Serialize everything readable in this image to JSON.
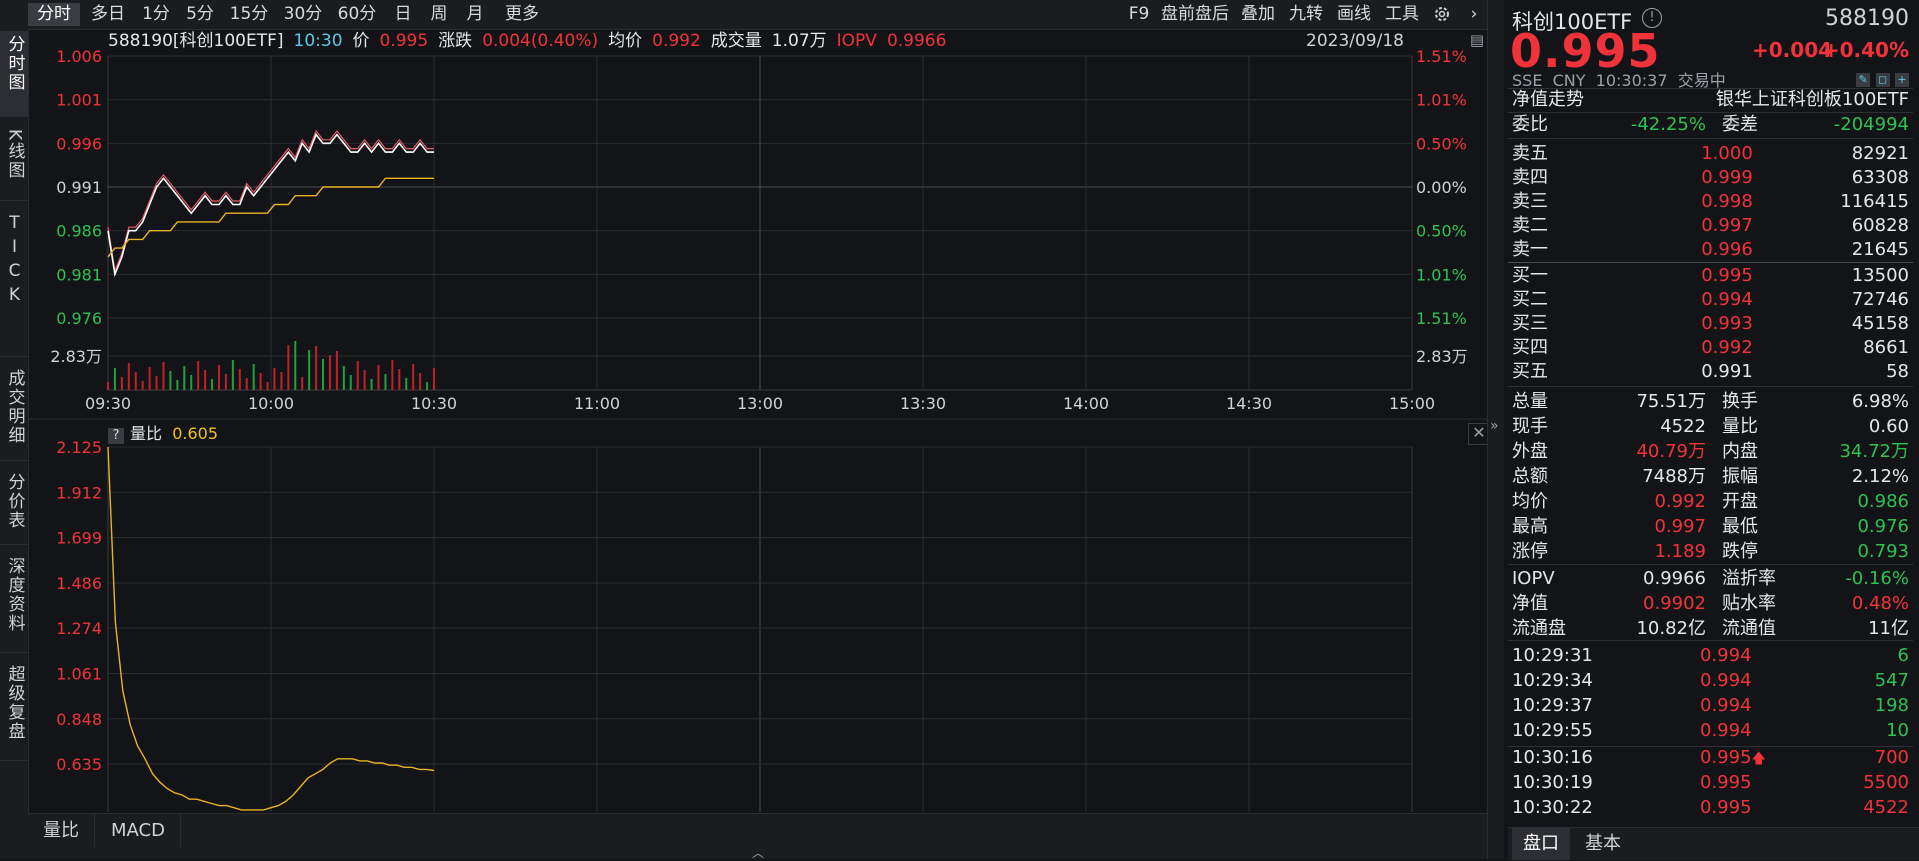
{
  "toolbar": {
    "periods": [
      "分时",
      "多日",
      "1分",
      "5分",
      "15分",
      "30分",
      "60分",
      "日",
      "周",
      "月",
      "更多"
    ],
    "tools": [
      "F9",
      "盘前盘后",
      "叠加",
      "九转",
      "画线",
      "工具"
    ]
  },
  "left_tabs": [
    "分时图",
    "K线图",
    "TICK",
    "成交明细",
    "分价表",
    "深度资料",
    "超级复盘"
  ],
  "info": {
    "code_name": "588190[科创100ETF]",
    "time": "10:30",
    "price_label": "价",
    "price": "0.995",
    "change_label": "涨跌",
    "change": "0.004(0.40%)",
    "avg_label": "均价",
    "avg": "0.992",
    "vol_label": "成交量",
    "vol": "1.07万",
    "iopv_label": "IOPV",
    "iopv": "0.9966",
    "date": "2023/09/18"
  },
  "chart_data": [
    {
      "type": "line",
      "x_ticks": [
        "09:30",
        "10:00",
        "10:30",
        "11:00",
        "13:00",
        "13:30",
        "14:00",
        "14:30",
        "15:00"
      ],
      "y_ticks_left": [
        "1.006",
        "1.001",
        "0.996",
        "0.991",
        "0.986",
        "0.981",
        "0.976"
      ],
      "y_ticks_right": [
        "1.51%",
        "1.01%",
        "0.50%",
        "0.00%",
        "0.50%",
        "1.01%",
        "1.51%"
      ],
      "ylim": [
        0.976,
        1.006
      ],
      "prev_close": 0.991,
      "volume_label": "2.83万",
      "series": [
        {
          "values": [
            0.986,
            0.981,
            0.983,
            0.986,
            0.986,
            0.987,
            0.989,
            0.991,
            0.992,
            0.991,
            0.99,
            0.989,
            0.988,
            0.989,
            0.99,
            0.989,
            0.989,
            0.99,
            0.989,
            0.989,
            0.991,
            0.99,
            0.991,
            0.992,
            0.993,
            0.994,
            0.995,
            0.994,
            0.996,
            0.995,
            0.997,
            0.996,
            0.996,
            0.997,
            0.996,
            0.995,
            0.995,
            0.996,
            0.995,
            0.996,
            0.995,
            0.995,
            0.996,
            0.995,
            0.995,
            0.996,
            0.995,
            0.995
          ]
        },
        {
          "values": [
            0.983,
            0.984,
            0.984,
            0.985,
            0.985,
            0.985,
            0.986,
            0.986,
            0.986,
            0.986,
            0.987,
            0.987,
            0.987,
            0.987,
            0.987,
            0.987,
            0.987,
            0.988,
            0.988,
            0.988,
            0.988,
            0.988,
            0.988,
            0.988,
            0.989,
            0.989,
            0.989,
            0.99,
            0.99,
            0.99,
            0.99,
            0.991,
            0.991,
            0.991,
            0.991,
            0.991,
            0.991,
            0.991,
            0.991,
            0.991,
            0.992,
            0.992,
            0.992,
            0.992,
            0.992,
            0.992,
            0.992,
            0.992
          ]
        }
      ]
    },
    {
      "type": "line",
      "title": "量比",
      "y_ticks": [
        "2.125",
        "1.912",
        "1.699",
        "1.486",
        "1.274",
        "1.061",
        "0.848",
        "0.635"
      ],
      "ylim": [
        0.41,
        2.125
      ],
      "series": [
        {
          "name": "量比",
          "values": [
            2.125,
            1.3,
            0.98,
            0.82,
            0.72,
            0.66,
            0.59,
            0.55,
            0.52,
            0.5,
            0.49,
            0.47,
            0.47,
            0.46,
            0.45,
            0.44,
            0.44,
            0.43,
            0.42,
            0.42,
            0.42,
            0.42,
            0.43,
            0.44,
            0.46,
            0.49,
            0.53,
            0.57,
            0.59,
            0.61,
            0.64,
            0.66,
            0.66,
            0.66,
            0.65,
            0.65,
            0.64,
            0.64,
            0.63,
            0.63,
            0.62,
            0.62,
            0.61,
            0.61,
            0.605
          ]
        }
      ]
    }
  ],
  "sub_pane": {
    "label": "量比",
    "value": "0.605"
  },
  "bottom_tabs": [
    "量比",
    "MACD"
  ],
  "quote": {
    "name": "科创100ETF",
    "code": "588190",
    "price": "0.995",
    "change": "+0.004",
    "change_pct": "+0.40%",
    "meta": "SSE  CNY  10:30:37  交易中",
    "trend_label": "净值走势",
    "index_name": "银华上证科创板100ETF"
  },
  "ratio": {
    "wb_label": "委比",
    "wb": "-42.25%",
    "wc_label": "委差",
    "wc": "-204994"
  },
  "asks": [
    {
      "label": "卖五",
      "price": "1.000",
      "vol": "82921"
    },
    {
      "label": "卖四",
      "price": "0.999",
      "vol": "63308"
    },
    {
      "label": "卖三",
      "price": "0.998",
      "vol": "116415"
    },
    {
      "label": "卖二",
      "price": "0.997",
      "vol": "60828"
    },
    {
      "label": "卖一",
      "price": "0.996",
      "vol": "21645"
    }
  ],
  "bids": [
    {
      "label": "买一",
      "price": "0.995",
      "vol": "13500"
    },
    {
      "label": "买二",
      "price": "0.994",
      "vol": "72746"
    },
    {
      "label": "买三",
      "price": "0.993",
      "vol": "45158"
    },
    {
      "label": "买四",
      "price": "0.992",
      "vol": "8661"
    },
    {
      "label": "买五",
      "price": "0.991",
      "vol": "58"
    }
  ],
  "stats": [
    {
      "l1": "总量",
      "v1": "75.51万",
      "c1": "white",
      "l2": "换手",
      "v2": "6.98%",
      "c2": "white"
    },
    {
      "l1": "现手",
      "v1": "4522",
      "c1": "white",
      "l2": "量比",
      "v2": "0.60",
      "c2": "white"
    },
    {
      "l1": "外盘",
      "v1": "40.79万",
      "c1": "red",
      "l2": "内盘",
      "v2": "34.72万",
      "c2": "green"
    },
    {
      "l1": "总额",
      "v1": "7488万",
      "c1": "white",
      "l2": "振幅",
      "v2": "2.12%",
      "c2": "white"
    },
    {
      "l1": "均价",
      "v1": "0.992",
      "c1": "red",
      "l2": "开盘",
      "v2": "0.986",
      "c2": "green"
    },
    {
      "l1": "最高",
      "v1": "0.997",
      "c1": "red",
      "l2": "最低",
      "v2": "0.976",
      "c2": "green"
    },
    {
      "l1": "涨停",
      "v1": "1.189",
      "c1": "red",
      "l2": "跌停",
      "v2": "0.793",
      "c2": "green"
    },
    {
      "l1": "IOPV",
      "v1": "0.9966",
      "c1": "white",
      "l2": "溢折率",
      "v2": "-0.16%",
      "c2": "green"
    },
    {
      "l1": "净值",
      "v1": "0.9902",
      "c1": "red",
      "l2": "贴水率",
      "v2": "0.48%",
      "c2": "red"
    },
    {
      "l1": "流通盘",
      "v1": "10.82亿",
      "c1": "white",
      "l2": "流通值",
      "v2": "11亿",
      "c2": "white"
    }
  ],
  "trades": [
    {
      "time": "10:29:31",
      "price": "0.994",
      "vol": "6",
      "vc": "green"
    },
    {
      "time": "10:29:34",
      "price": "0.994",
      "vol": "547",
      "vc": "green"
    },
    {
      "time": "10:29:37",
      "price": "0.994",
      "vol": "198",
      "vc": "green"
    },
    {
      "time": "10:29:55",
      "price": "0.994",
      "vol": "10",
      "vc": "green"
    },
    {
      "time": "10:30:16",
      "price": "0.995",
      "vol": "700",
      "vc": "red",
      "up": true
    },
    {
      "time": "10:30:19",
      "price": "0.995",
      "vol": "5500",
      "vc": "red"
    },
    {
      "time": "10:30:22",
      "price": "0.995",
      "vol": "4522",
      "vc": "red"
    }
  ],
  "rp_tabs": [
    "盘口",
    "基本"
  ]
}
